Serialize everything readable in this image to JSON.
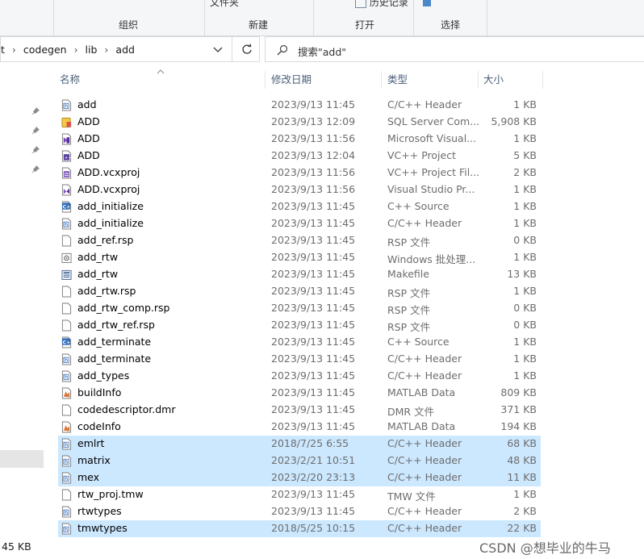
{
  "ribbon": {
    "top_folder": "文件夹",
    "top_history": "历史记录",
    "group_organize": "组织",
    "group_new": "新建",
    "group_open": "打开",
    "group_select": "选择"
  },
  "address": {
    "path": [
      "t",
      "codegen",
      "lib",
      "add"
    ],
    "separator": "›",
    "search_placeholder": "搜索\"add\""
  },
  "columns": {
    "name": "名称",
    "date": "修改日期",
    "type": "类型",
    "size": "大小"
  },
  "files": [
    {
      "name": "add",
      "date": "2023/9/13 11:45",
      "type": "C/C++ Header",
      "size": "1 KB",
      "icon": "header-file-icon",
      "selected": false
    },
    {
      "name": "ADD",
      "date": "2023/9/13 12:09",
      "type": "SQL Server Com...",
      "size": "5,908 KB",
      "icon": "sql-database-icon",
      "selected": false
    },
    {
      "name": "ADD",
      "date": "2023/9/13 11:56",
      "type": "Microsoft Visual...",
      "size": "1 KB",
      "icon": "visual-studio-solution-icon",
      "selected": false
    },
    {
      "name": "ADD",
      "date": "2023/9/13 12:04",
      "type": "VC++ Project",
      "size": "5 KB",
      "icon": "vcxproj-icon",
      "selected": false
    },
    {
      "name": "ADD.vcxproj",
      "date": "2023/9/13 11:56",
      "type": "VC++ Project Fil...",
      "size": "2 KB",
      "icon": "vcxproj-filters-icon",
      "selected": false
    },
    {
      "name": "ADD.vcxproj",
      "date": "2023/9/13 11:56",
      "type": "Visual Studio Pr...",
      "size": "1 KB",
      "icon": "visual-studio-user-icon",
      "selected": false
    },
    {
      "name": "add_initialize",
      "date": "2023/9/13 11:45",
      "type": "C++ Source",
      "size": "1 KB",
      "icon": "cpp-source-icon",
      "selected": false
    },
    {
      "name": "add_initialize",
      "date": "2023/9/13 11:45",
      "type": "C/C++ Header",
      "size": "1 KB",
      "icon": "header-file-icon",
      "selected": false
    },
    {
      "name": "add_ref.rsp",
      "date": "2023/9/13 11:45",
      "type": "RSP 文件",
      "size": "0 KB",
      "icon": "blank-file-icon",
      "selected": false
    },
    {
      "name": "add_rtw",
      "date": "2023/9/13 11:45",
      "type": "Windows 批处理...",
      "size": "1 KB",
      "icon": "batch-file-icon",
      "selected": false
    },
    {
      "name": "add_rtw",
      "date": "2023/9/13 11:45",
      "type": "Makefile",
      "size": "13 KB",
      "icon": "makefile-icon",
      "selected": false
    },
    {
      "name": "add_rtw.rsp",
      "date": "2023/9/13 11:45",
      "type": "RSP 文件",
      "size": "1 KB",
      "icon": "blank-file-icon",
      "selected": false
    },
    {
      "name": "add_rtw_comp.rsp",
      "date": "2023/9/13 11:45",
      "type": "RSP 文件",
      "size": "0 KB",
      "icon": "blank-file-icon",
      "selected": false
    },
    {
      "name": "add_rtw_ref.rsp",
      "date": "2023/9/13 11:45",
      "type": "RSP 文件",
      "size": "0 KB",
      "icon": "blank-file-icon",
      "selected": false
    },
    {
      "name": "add_terminate",
      "date": "2023/9/13 11:45",
      "type": "C++ Source",
      "size": "1 KB",
      "icon": "cpp-source-icon",
      "selected": false
    },
    {
      "name": "add_terminate",
      "date": "2023/9/13 11:45",
      "type": "C/C++ Header",
      "size": "1 KB",
      "icon": "header-file-icon",
      "selected": false
    },
    {
      "name": "add_types",
      "date": "2023/9/13 11:45",
      "type": "C/C++ Header",
      "size": "1 KB",
      "icon": "header-file-icon",
      "selected": false
    },
    {
      "name": "buildInfo",
      "date": "2023/9/13 11:45",
      "type": "MATLAB Data",
      "size": "809 KB",
      "icon": "matlab-data-icon",
      "selected": false
    },
    {
      "name": "codedescriptor.dmr",
      "date": "2023/9/13 11:45",
      "type": "DMR 文件",
      "size": "371 KB",
      "icon": "blank-file-icon",
      "selected": false
    },
    {
      "name": "codeInfo",
      "date": "2023/9/13 11:45",
      "type": "MATLAB Data",
      "size": "194 KB",
      "icon": "matlab-data-icon",
      "selected": false
    },
    {
      "name": "emlrt",
      "date": "2018/7/25 6:55",
      "type": "C/C++ Header",
      "size": "68 KB",
      "icon": "header-file-icon",
      "selected": true
    },
    {
      "name": "matrix",
      "date": "2023/2/21 10:51",
      "type": "C/C++ Header",
      "size": "48 KB",
      "icon": "header-file-icon",
      "selected": true
    },
    {
      "name": "mex",
      "date": "2023/2/20 23:13",
      "type": "C/C++ Header",
      "size": "11 KB",
      "icon": "header-file-icon",
      "selected": true
    },
    {
      "name": "rtw_proj.tmw",
      "date": "2023/9/13 11:45",
      "type": "TMW 文件",
      "size": "1 KB",
      "icon": "blank-file-icon",
      "selected": false
    },
    {
      "name": "rtwtypes",
      "date": "2023/9/13 11:45",
      "type": "C/C++ Header",
      "size": "2 KB",
      "icon": "header-file-icon",
      "selected": false
    },
    {
      "name": "tmwtypes",
      "date": "2018/5/25 10:15",
      "type": "C/C++ Header",
      "size": "22 KB",
      "icon": "header-file-icon",
      "selected": true
    }
  ],
  "status": {
    "size_text": "45 KB"
  },
  "watermark": "CSDN @想毕业的牛马",
  "colors": {
    "selection": "#cce8ff",
    "header_text": "#4c607a",
    "secondary_text": "#6d6d6d"
  }
}
